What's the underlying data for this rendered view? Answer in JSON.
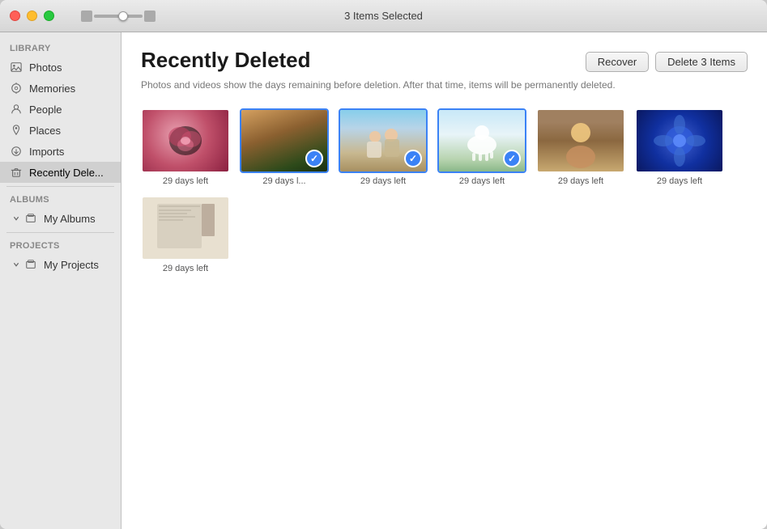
{
  "titlebar": {
    "title": "3 Items Selected"
  },
  "sidebar": {
    "library_label": "Library",
    "items": [
      {
        "id": "photos",
        "label": "Photos",
        "icon": "image-icon"
      },
      {
        "id": "memories",
        "label": "Memories",
        "icon": "film-icon"
      },
      {
        "id": "people",
        "label": "People",
        "icon": "person-icon"
      },
      {
        "id": "places",
        "label": "Places",
        "icon": "pin-icon"
      },
      {
        "id": "imports",
        "label": "Imports",
        "icon": "import-icon"
      },
      {
        "id": "recently-deleted",
        "label": "Recently Dele...",
        "icon": "trash-icon",
        "active": true
      }
    ],
    "albums_label": "Albums",
    "albums_items": [
      {
        "id": "my-albums",
        "label": "My Albums",
        "icon": "albums-icon"
      }
    ],
    "projects_label": "Projects",
    "projects_items": [
      {
        "id": "my-projects",
        "label": "My Projects",
        "icon": "projects-icon"
      }
    ]
  },
  "content": {
    "page_title": "Recently Deleted",
    "recover_button": "Recover",
    "delete_button": "Delete 3 Items",
    "description": "Photos and videos show the days remaining before deletion. After that time, items will be permanently deleted.",
    "photos": [
      {
        "id": "rose",
        "type": "rose",
        "days_left": "29 days left",
        "selected": false
      },
      {
        "id": "forest",
        "type": "forest",
        "days_left": "29 days l...",
        "selected": true
      },
      {
        "id": "couple",
        "type": "couple",
        "days_left": "29 days left",
        "selected": true
      },
      {
        "id": "goat",
        "type": "goat",
        "days_left": "29 days left",
        "selected": true
      },
      {
        "id": "portrait",
        "type": "portrait",
        "days_left": "29 days left",
        "selected": false
      },
      {
        "id": "blue-flower",
        "type": "blue-flower",
        "days_left": "29 days left",
        "selected": false
      },
      {
        "id": "screenshot",
        "type": "screenshot",
        "days_left": "29 days left",
        "selected": false
      }
    ]
  }
}
